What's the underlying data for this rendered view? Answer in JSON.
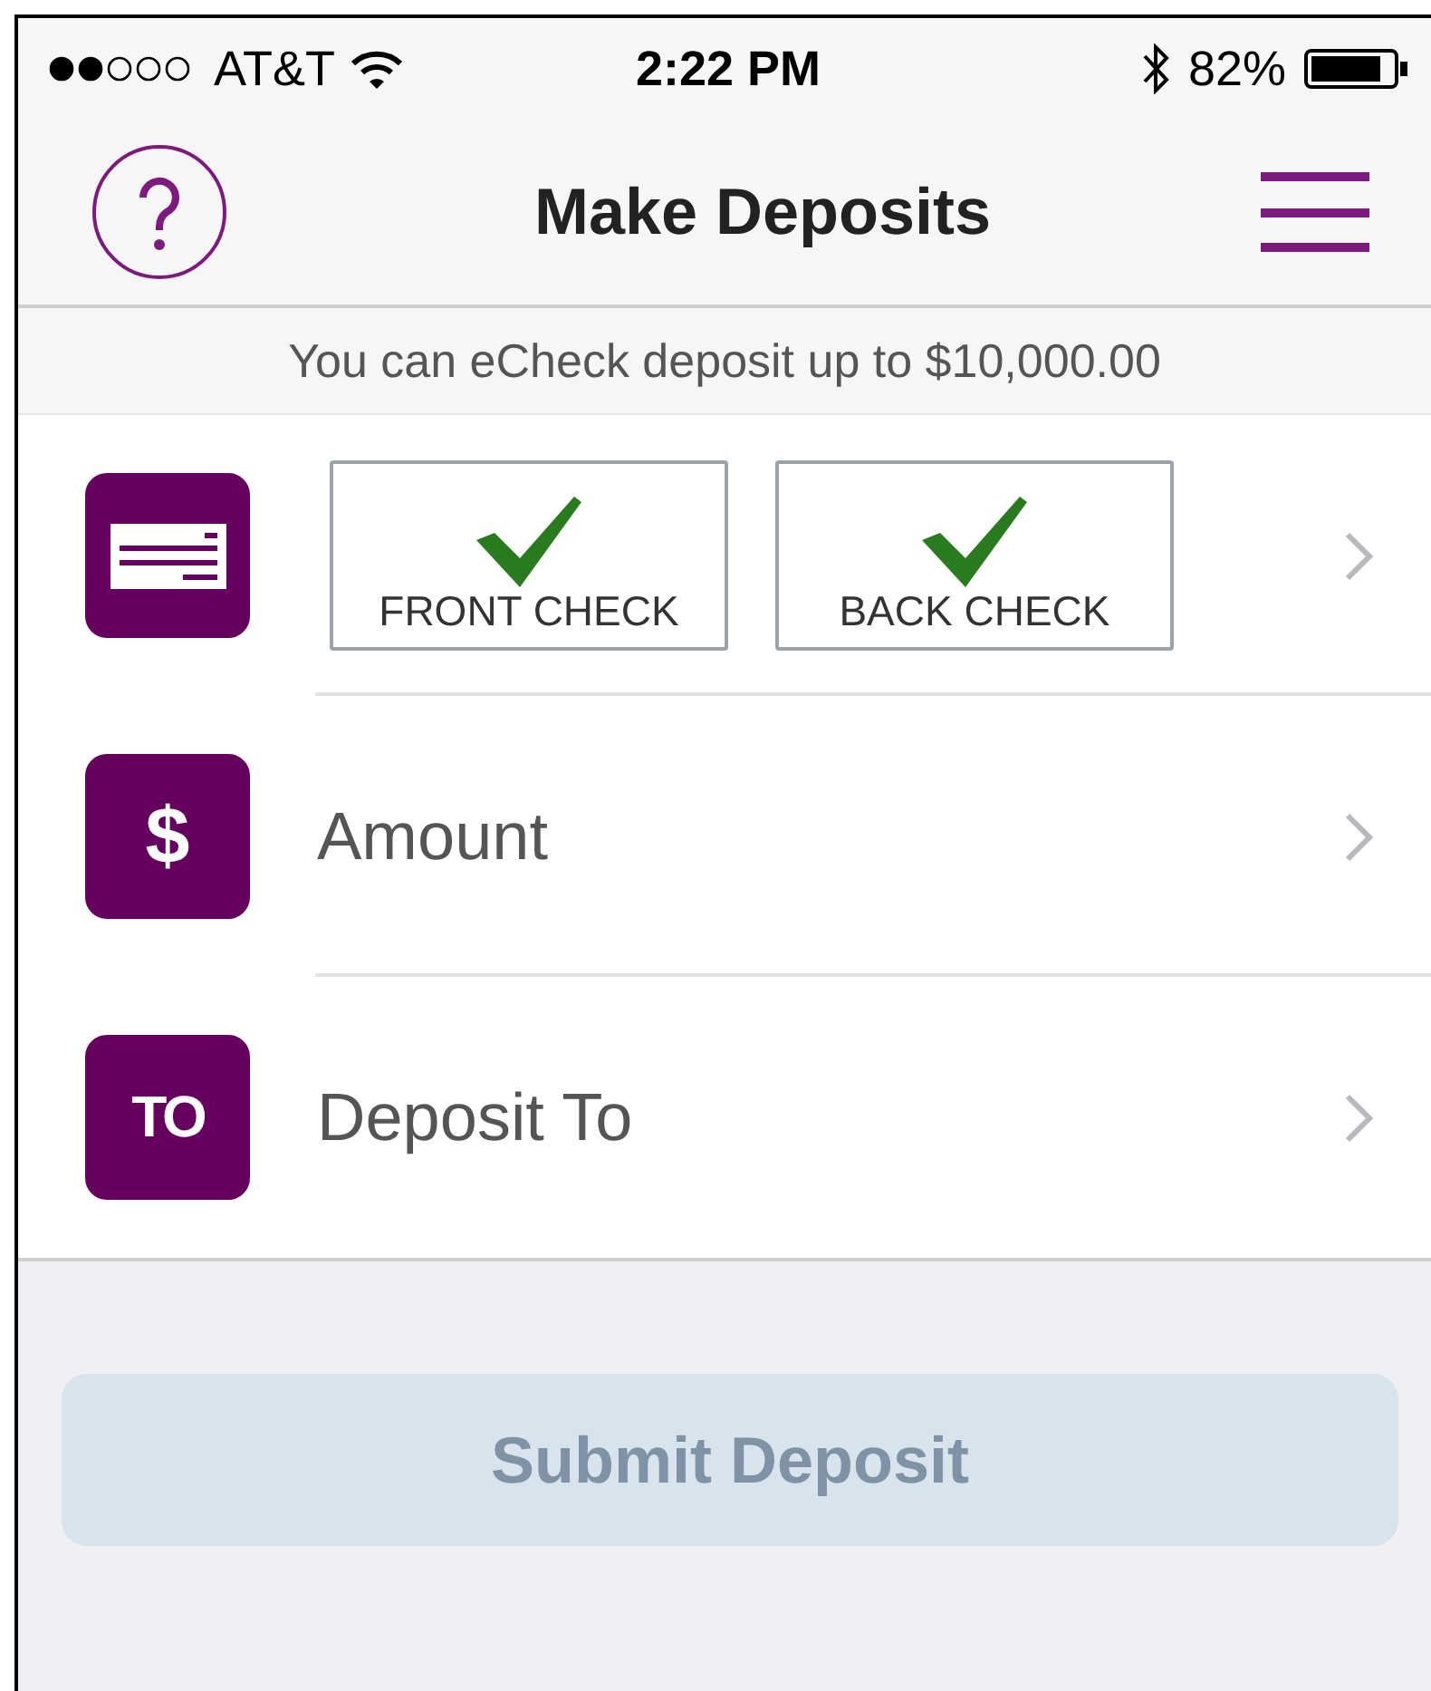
{
  "status_bar": {
    "carrier": "AT&T",
    "time": "2:22 PM",
    "battery": "82%"
  },
  "nav_bar": {
    "title": "Make Deposits"
  },
  "notice": "You can eCheck deposit up to $10,000.00",
  "rows": [
    {
      "kind": "check_images",
      "images": [
        {
          "label": "FRONT CHECK",
          "captured": true
        },
        {
          "label": "BACK CHECK",
          "captured": true
        }
      ]
    },
    {
      "kind": "field",
      "icon_text": "$",
      "label": "Amount"
    },
    {
      "kind": "field",
      "icon_text": "TO",
      "label": "Deposit To"
    }
  ],
  "submit_button": {
    "label": "Submit Deposit",
    "disabled": true
  }
}
